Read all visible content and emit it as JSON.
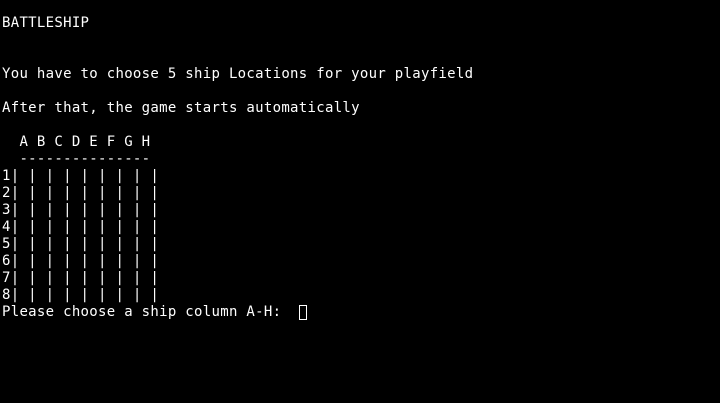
{
  "terminal": {
    "title": "BATTLESHIP",
    "intro_line1": "You have to choose 5 ship Locations for your playfield",
    "intro_line2": "After that, the game starts automatically",
    "board": {
      "column_header": "  A B C D E F G H",
      "divider": "  ---------------",
      "rows": [
        "1| | | | | | | | |",
        "2| | | | | | | | |",
        "3| | | | | | | | |",
        "4| | | | | | | | |",
        "5| | | | | | | | |",
        "6| | | | | | | | |",
        "7| | | | | | | | |",
        "8| | | | | | | | |"
      ]
    },
    "prompt": "Please choose a ship column A-H: ",
    "input_value": ""
  }
}
